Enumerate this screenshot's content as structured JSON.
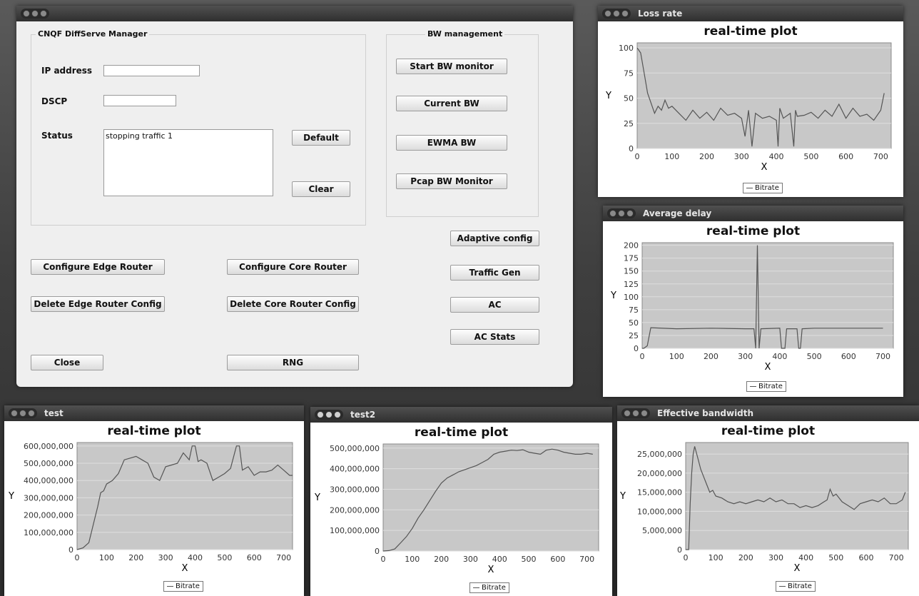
{
  "main_window": {
    "group_left": {
      "title": "CNQF DiffServe Manager"
    },
    "group_right": {
      "title": "BW management"
    },
    "labels": {
      "ip_address": "IP address",
      "dscp": "DSCP",
      "status": "Status"
    },
    "fields": {
      "ip_address": "",
      "dscp": "",
      "status": "stopping traffic 1"
    },
    "buttons": {
      "default": "Default",
      "clear": "Clear",
      "start_bw_monitor": "Start BW monitor",
      "current_bw": "Current BW",
      "ewma_bw": "EWMA BW",
      "pcap_bw_monitor": "Pcap BW Monitor",
      "adaptive_config": "Adaptive config",
      "traffic_gen": "Traffic Gen",
      "ac": "AC",
      "ac_stats": "AC Stats",
      "configure_edge_router": "Configure Edge Router",
      "configure_core_router": "Configure Core Router",
      "delete_edge_router_config": "Delete Edge Router Config",
      "delete_core_router_config": "Delete Core Router Config",
      "close": "Close",
      "rng": "RNG"
    }
  },
  "plot_windows": [
    {
      "window_title": "Loss rate",
      "plot_title": "real-time plot",
      "xlabel": "X",
      "ylabel": "Y",
      "legend": "Bitrate",
      "y_ticks": [
        "100",
        "75",
        "50",
        "25",
        "0"
      ],
      "x_ticks": [
        "0",
        "100",
        "200",
        "300",
        "400",
        "500",
        "600",
        "700"
      ]
    },
    {
      "window_title": "Average delay",
      "plot_title": "real-time plot",
      "xlabel": "X",
      "ylabel": "Y",
      "legend": "Bitrate",
      "y_ticks": [
        "200",
        "175",
        "150",
        "125",
        "100",
        "75",
        "50",
        "25",
        "0"
      ],
      "x_ticks": [
        "0",
        "100",
        "200",
        "300",
        "400",
        "500",
        "600",
        "700"
      ]
    },
    {
      "window_title": "test",
      "plot_title": "real-time plot",
      "xlabel": "X",
      "ylabel": "Y",
      "legend": "Bitrate",
      "y_ticks": [
        "600,000,000",
        "500,000,000",
        "400,000,000",
        "300,000,000",
        "200,000,000",
        "100,000,000",
        "0"
      ],
      "x_ticks": [
        "0",
        "100",
        "200",
        "300",
        "400",
        "500",
        "600",
        "700"
      ]
    },
    {
      "window_title": "test2",
      "plot_title": "real-time plot",
      "xlabel": "X",
      "ylabel": "Y",
      "legend": "Bitrate",
      "y_ticks": [
        "500,000,000",
        "400,000,000",
        "300,000,000",
        "200,000,000",
        "100,000,000",
        "0"
      ],
      "x_ticks": [
        "0",
        "100",
        "200",
        "300",
        "400",
        "500",
        "600",
        "700"
      ]
    },
    {
      "window_title": "Effective bandwidth",
      "plot_title": "real-time plot",
      "xlabel": "X",
      "ylabel": "Y",
      "legend": "Bitrate",
      "y_ticks": [
        "25,000,000",
        "20,000,000",
        "15,000,000",
        "10,000,000",
        "5,000,000",
        "0"
      ],
      "x_ticks": [
        "0",
        "100",
        "200",
        "300",
        "400",
        "500",
        "600",
        "700"
      ]
    }
  ],
  "chart_data": [
    {
      "type": "line",
      "title": "real-time plot",
      "xlabel": "X",
      "ylabel": "Y",
      "xlim": [
        0,
        730
      ],
      "ylim": [
        0,
        105
      ],
      "series": [
        {
          "name": "Bitrate",
          "x": [
            0,
            10,
            20,
            30,
            40,
            50,
            60,
            70,
            80,
            90,
            100,
            120,
            140,
            160,
            180,
            200,
            220,
            240,
            260,
            280,
            300,
            310,
            320,
            330,
            340,
            360,
            380,
            400,
            405,
            410,
            420,
            440,
            450,
            455,
            460,
            480,
            500,
            520,
            540,
            560,
            580,
            600,
            620,
            640,
            660,
            680,
            700,
            710
          ],
          "y": [
            100,
            95,
            75,
            55,
            45,
            35,
            42,
            38,
            48,
            40,
            42,
            35,
            28,
            38,
            30,
            36,
            28,
            40,
            33,
            35,
            30,
            12,
            38,
            2,
            35,
            30,
            32,
            28,
            2,
            40,
            30,
            35,
            2,
            38,
            32,
            33,
            36,
            30,
            38,
            32,
            44,
            30,
            40,
            32,
            34,
            28,
            38,
            55
          ]
        }
      ]
    },
    {
      "type": "line",
      "title": "real-time plot",
      "xlabel": "X",
      "ylabel": "Y",
      "xlim": [
        0,
        730
      ],
      "ylim": [
        0,
        205
      ],
      "series": [
        {
          "name": "Bitrate",
          "x": [
            0,
            5,
            15,
            25,
            100,
            200,
            300,
            325,
            330,
            335,
            340,
            345,
            400,
            405,
            415,
            420,
            450,
            455,
            460,
            465,
            500,
            600,
            700
          ],
          "y": [
            0,
            0,
            5,
            40,
            38,
            39,
            38,
            38,
            0,
            200,
            0,
            38,
            39,
            0,
            0,
            38,
            38,
            0,
            0,
            38,
            39,
            39,
            39
          ]
        }
      ]
    },
    {
      "type": "line",
      "title": "real-time plot",
      "xlabel": "X",
      "ylabel": "Y",
      "xlim": [
        0,
        730
      ],
      "ylim": [
        0,
        620000000
      ],
      "series": [
        {
          "name": "Bitrate",
          "x": [
            0,
            20,
            40,
            60,
            70,
            80,
            90,
            100,
            120,
            140,
            160,
            180,
            200,
            220,
            240,
            260,
            280,
            300,
            320,
            340,
            360,
            380,
            390,
            400,
            410,
            420,
            440,
            460,
            480,
            500,
            520,
            540,
            550,
            560,
            580,
            600,
            620,
            640,
            660,
            680,
            700,
            720,
            730
          ],
          "y": [
            0,
            10000000,
            40000000,
            180000000,
            250000000,
            330000000,
            340000000,
            380000000,
            400000000,
            440000000,
            520000000,
            530000000,
            540000000,
            520000000,
            500000000,
            420000000,
            400000000,
            480000000,
            490000000,
            500000000,
            560000000,
            520000000,
            600000000,
            600000000,
            510000000,
            520000000,
            500000000,
            400000000,
            420000000,
            440000000,
            470000000,
            600000000,
            600000000,
            460000000,
            480000000,
            430000000,
            450000000,
            450000000,
            460000000,
            490000000,
            460000000,
            430000000,
            430000000
          ]
        }
      ]
    },
    {
      "type": "line",
      "title": "real-time plot",
      "xlabel": "X",
      "ylabel": "Y",
      "xlim": [
        0,
        740
      ],
      "ylim": [
        0,
        520000000
      ],
      "series": [
        {
          "name": "Bitrate",
          "x": [
            0,
            20,
            40,
            60,
            80,
            100,
            120,
            140,
            160,
            180,
            200,
            220,
            240,
            260,
            280,
            300,
            320,
            340,
            360,
            380,
            400,
            420,
            440,
            460,
            480,
            500,
            520,
            540,
            560,
            580,
            600,
            620,
            640,
            660,
            680,
            700,
            720
          ],
          "y": [
            0,
            2000000,
            10000000,
            40000000,
            70000000,
            110000000,
            160000000,
            200000000,
            245000000,
            290000000,
            330000000,
            355000000,
            370000000,
            385000000,
            395000000,
            405000000,
            415000000,
            430000000,
            445000000,
            470000000,
            480000000,
            485000000,
            490000000,
            488000000,
            492000000,
            480000000,
            475000000,
            470000000,
            490000000,
            495000000,
            490000000,
            480000000,
            475000000,
            470000000,
            470000000,
            475000000,
            470000000
          ]
        }
      ]
    },
    {
      "type": "line",
      "title": "real-time plot",
      "xlabel": "X",
      "ylabel": "Y",
      "xlim": [
        0,
        740
      ],
      "ylim": [
        0,
        28000000
      ],
      "series": [
        {
          "name": "Bitrate",
          "x": [
            0,
            10,
            15,
            20,
            25,
            30,
            40,
            50,
            60,
            70,
            80,
            90,
            100,
            120,
            140,
            160,
            180,
            200,
            220,
            240,
            260,
            280,
            300,
            320,
            340,
            360,
            380,
            400,
            420,
            440,
            460,
            470,
            480,
            490,
            500,
            520,
            540,
            560,
            580,
            600,
            620,
            640,
            660,
            680,
            700,
            720,
            730
          ],
          "y": [
            0,
            0,
            12000000,
            20000000,
            25000000,
            27000000,
            24000000,
            21000000,
            19000000,
            17000000,
            15000000,
            15500000,
            14000000,
            13500000,
            12500000,
            12000000,
            12500000,
            12000000,
            12500000,
            13000000,
            12500000,
            13500000,
            12500000,
            13000000,
            12000000,
            12000000,
            11000000,
            11500000,
            11000000,
            11500000,
            12500000,
            13000000,
            15800000,
            14000000,
            14500000,
            12500000,
            11500000,
            10500000,
            12000000,
            12500000,
            13000000,
            12500000,
            13500000,
            12000000,
            12000000,
            13000000,
            15000000
          ]
        }
      ]
    }
  ]
}
